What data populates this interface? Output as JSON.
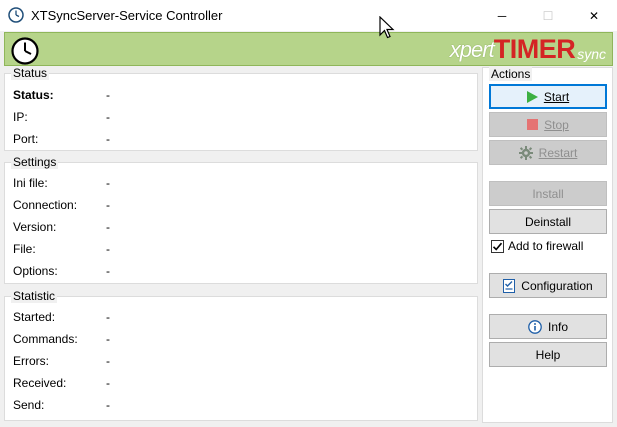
{
  "window": {
    "title": "XTSyncServer-Service Controller",
    "minimize_glyph": "─",
    "maximize_glyph": "☐",
    "close_glyph": "✕"
  },
  "banner": {
    "logo_xpert": "xpert",
    "logo_timer": "TIMER",
    "logo_sync": "sync"
  },
  "status": {
    "title": "Status",
    "rows": [
      {
        "label": "Status:",
        "value": "-"
      },
      {
        "label": "IP:",
        "value": "-"
      },
      {
        "label": "Port:",
        "value": "-"
      }
    ]
  },
  "settings": {
    "title": "Settings",
    "rows": [
      {
        "label": "Ini file:",
        "value": "-"
      },
      {
        "label": "Connection:",
        "value": "-"
      },
      {
        "label": "Version:",
        "value": "-"
      },
      {
        "label": "File:",
        "value": "-"
      },
      {
        "label": "Options:",
        "value": "-"
      }
    ]
  },
  "statistic": {
    "title": "Statistic",
    "rows": [
      {
        "label": "Started:",
        "value": "-"
      },
      {
        "label": "Commands:",
        "value": "-"
      },
      {
        "label": "Errors:",
        "value": "-"
      },
      {
        "label": "Received:",
        "value": "-"
      },
      {
        "label": "Send:",
        "value": "-"
      }
    ]
  },
  "actions": {
    "title": "Actions",
    "start": "Start",
    "stop": "Stop",
    "restart": "Restart",
    "install": "Install",
    "deinstall": "Deinstall",
    "add_to_firewall": "Add to firewall",
    "add_to_firewall_checked": true,
    "configuration": "Configuration",
    "info": "Info",
    "help": "Help"
  },
  "colors": {
    "banner_green": "#b6d48a",
    "accent_blue": "#0078d7",
    "timer_red": "#d42424",
    "play_green": "#3cb043",
    "stop_red": "#e57373"
  }
}
